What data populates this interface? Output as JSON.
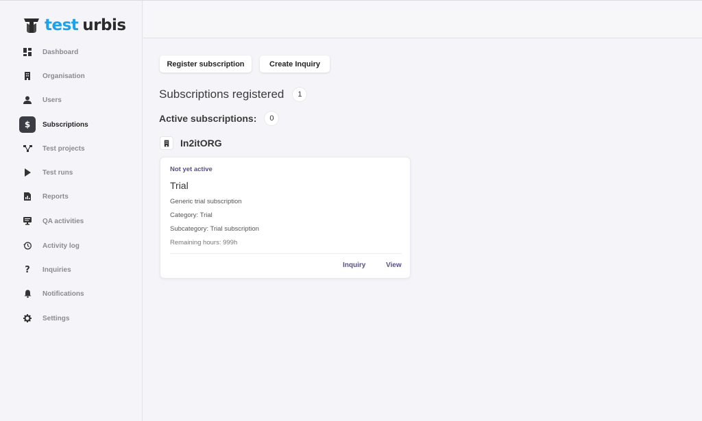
{
  "brand": {
    "part1": "test",
    "part2": "urbis",
    "color_primary": "#1da1e8",
    "color_dark": "#2b2b2b"
  },
  "sidebar": {
    "items": [
      {
        "label": "Dashboard",
        "icon": "dashboard-icon",
        "active": false
      },
      {
        "label": "Organisation",
        "icon": "building-icon",
        "active": false
      },
      {
        "label": "Users",
        "icon": "user-icon",
        "active": false
      },
      {
        "label": "Subscriptions",
        "icon": "dollar-icon",
        "active": true
      },
      {
        "label": "Test projects",
        "icon": "network-icon",
        "active": false
      },
      {
        "label": "Test runs",
        "icon": "play-icon",
        "active": false
      },
      {
        "label": "Reports",
        "icon": "report-icon",
        "active": false
      },
      {
        "label": "QA activities",
        "icon": "monitor-icon",
        "active": false
      },
      {
        "label": "Activity log",
        "icon": "history-icon",
        "active": false
      },
      {
        "label": "Inquiries",
        "icon": "question-icon",
        "active": false
      },
      {
        "label": "Notifications",
        "icon": "bell-icon",
        "active": false
      },
      {
        "label": "Settings",
        "icon": "gear-icon",
        "active": false
      }
    ]
  },
  "toolbar": {
    "register_label": "Register subscription",
    "inquiry_label": "Create Inquiry"
  },
  "summary": {
    "registered_label": "Subscriptions registered",
    "registered_count": "1",
    "active_label": "Active subscriptions:",
    "active_count": "0"
  },
  "organization": {
    "name": "In2itORG",
    "icon": "building-icon"
  },
  "subscription_card": {
    "status": "Not yet active",
    "title": "Trial",
    "description": "Generic trial subscription",
    "category": "Category: Trial",
    "subcategory": "Subcategory: Trial subscription",
    "remaining": "Remaining hours: 999h",
    "inquiry_link": "Inquiry",
    "view_link": "View",
    "accent_color": "#5a4e8a"
  }
}
